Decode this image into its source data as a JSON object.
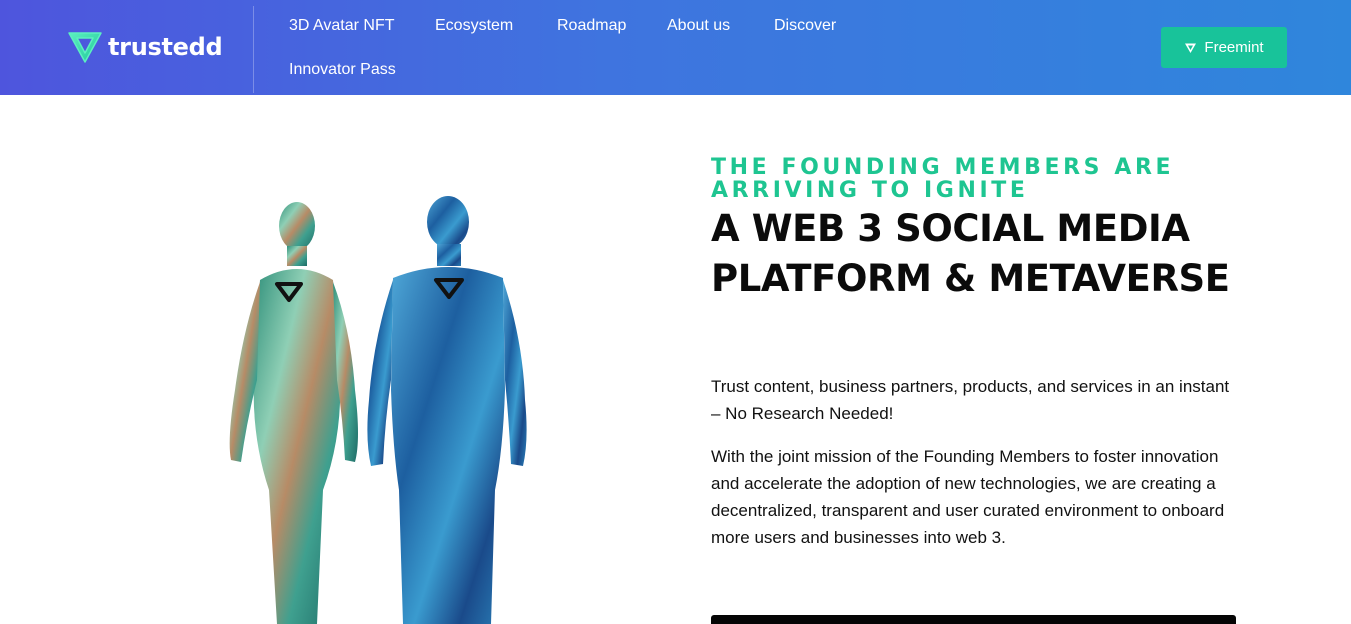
{
  "header": {
    "logo_text": "trustedd",
    "nav": [
      "3D Avatar NFT",
      "Ecosystem",
      "Roadmap",
      "About us",
      "Discover",
      "Innovator Pass"
    ],
    "cta_label": "Freemint"
  },
  "hero": {
    "eyebrow": "THE FOUNDING MEMBERS ARE ARRIVING TO IGNITE",
    "headline": "A WEB 3 SOCIAL MEDIA PLATFORM & METAVERSE",
    "paragraph_1": "Trust content, business partners, products, and services in an instant – No Research Needed!",
    "paragraph_2": "With the joint mission of the Founding Members to foster innovation and accelerate the adoption of new technologies, we are creating a decentralized, transparent and user curated environment to onboard more users and businesses into web 3."
  },
  "colors": {
    "header_start": "#4e55dd",
    "header_end": "#2f86dc",
    "accent": "#1ec591",
    "button": "#18c39a"
  },
  "icons": [
    "trustedd-logo-icon",
    "freemint-triangle-icon",
    "avatar-triangle-emblem"
  ]
}
